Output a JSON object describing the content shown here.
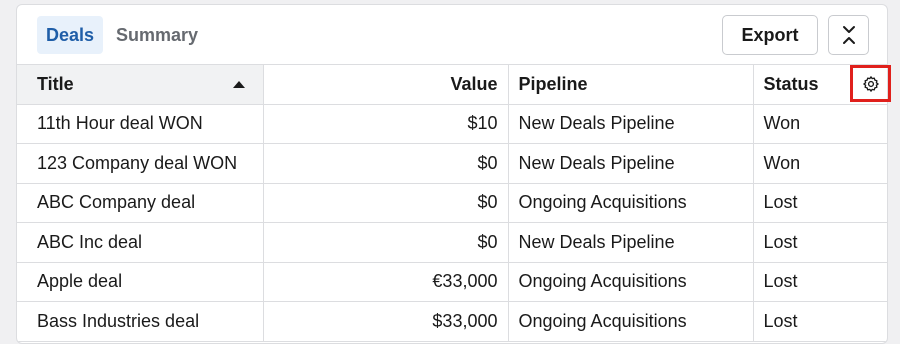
{
  "tabs": [
    {
      "label": "Deals",
      "active": true
    },
    {
      "label": "Summary",
      "active": false
    }
  ],
  "toolbar": {
    "export_label": "Export",
    "collapse_icon": "collapse-icon"
  },
  "table": {
    "columns": [
      "Title",
      "Value",
      "Pipeline",
      "Status"
    ],
    "sort": {
      "column": "Title",
      "direction": "ascending"
    },
    "settings_icon": "gear-icon",
    "rows": [
      [
        "11th Hour deal WON",
        "$10",
        "New Deals Pipeline",
        "Won"
      ],
      [
        "123 Company deal WON",
        "$0",
        "New Deals Pipeline",
        "Won"
      ],
      [
        "ABC Company deal",
        "$0",
        "Ongoing Acquisitions",
        "Lost"
      ],
      [
        "ABC Inc deal",
        "$0",
        "New Deals Pipeline",
        "Lost"
      ],
      [
        "Apple deal",
        "€33,000",
        "Ongoing Acquisitions",
        "Lost"
      ],
      [
        "Bass Industries deal",
        "$33,000",
        "Ongoing Acquisitions",
        "Lost"
      ]
    ]
  },
  "colors": {
    "active_tab_bg": "#e8f1fb",
    "active_tab_text": "#1f5ea8",
    "highlight_box": "#e0201c"
  }
}
